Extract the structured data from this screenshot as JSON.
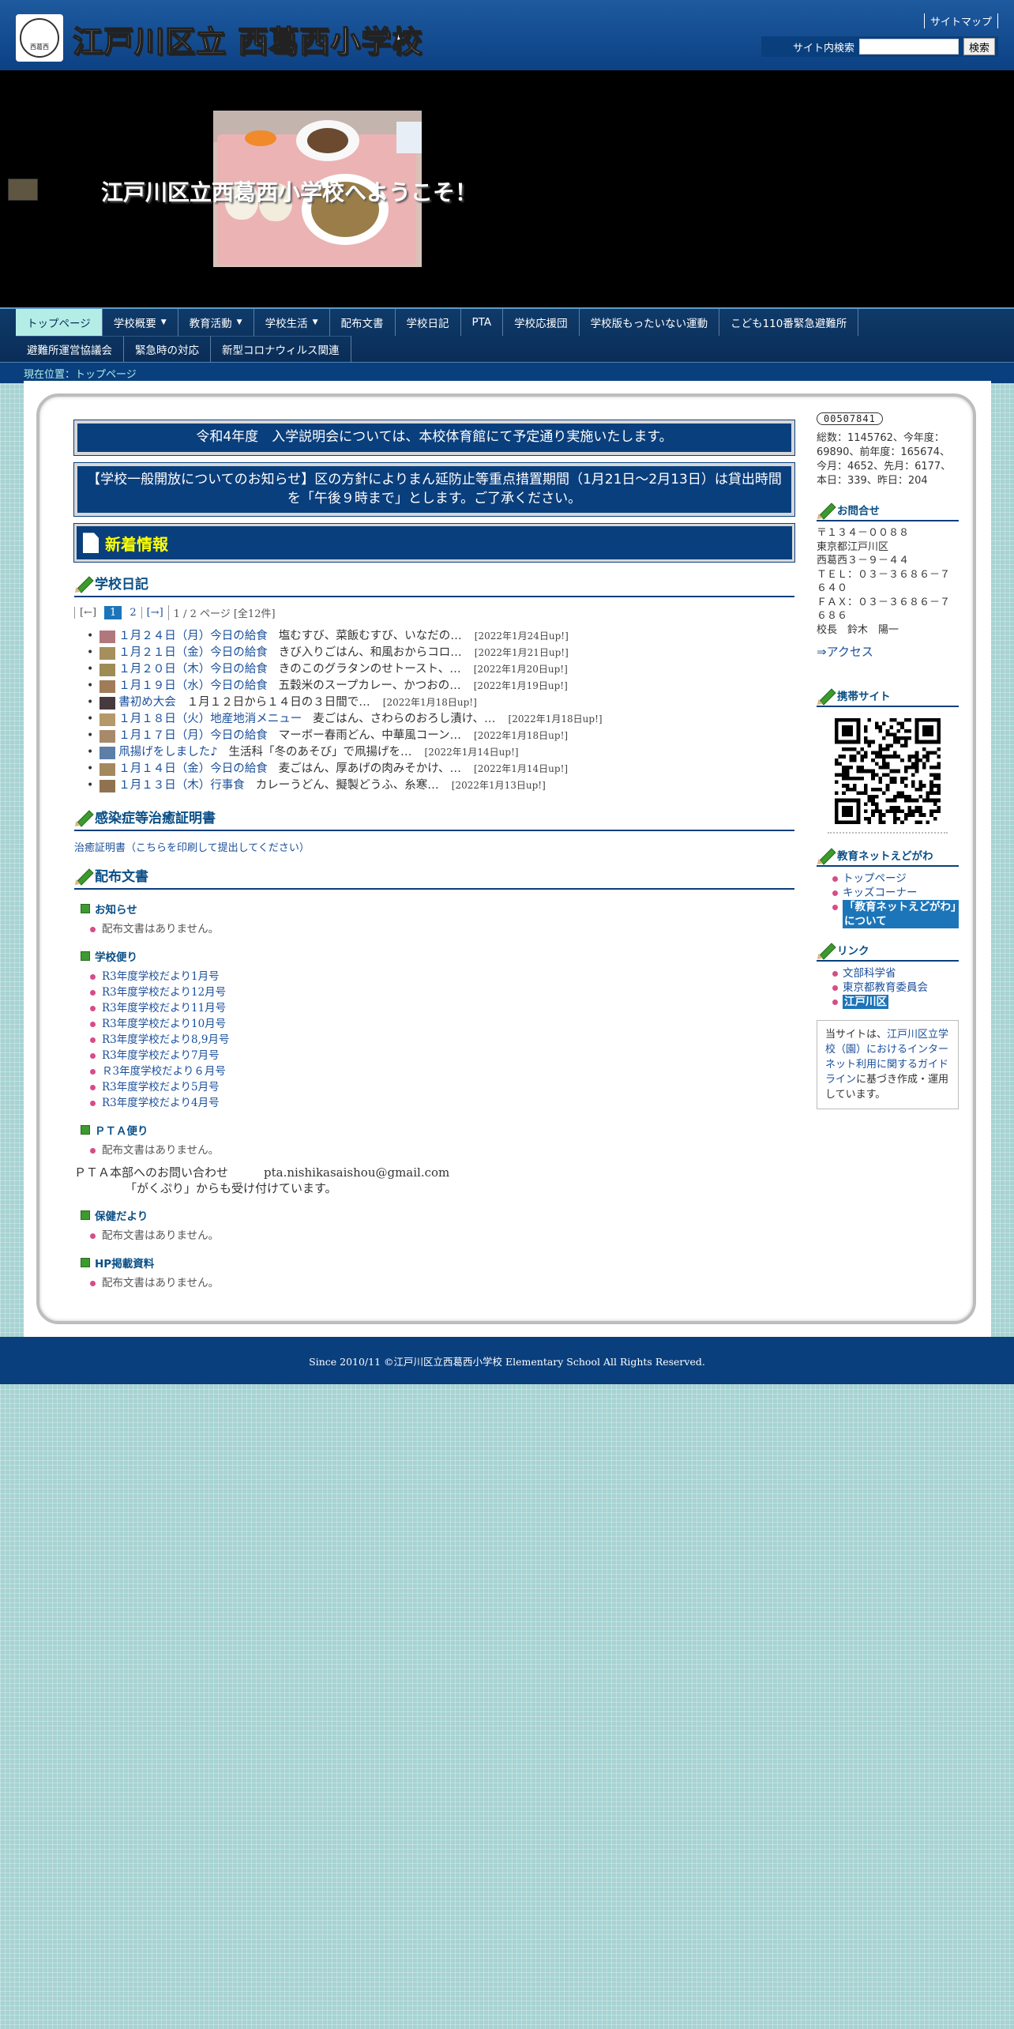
{
  "header": {
    "logo_alt": "西葛西",
    "site_title": "江戸川区立 西葛西小学校",
    "sitemap": "サイトマップ",
    "search_label": "サイト内検索",
    "search_value": "",
    "search_button": "検索"
  },
  "banner": {
    "title": "江戸川区立西葛西小学校へようこそ！"
  },
  "nav": {
    "row1": [
      {
        "label": "トップページ",
        "dropdown": false
      },
      {
        "label": "学校概要",
        "dropdown": true
      },
      {
        "label": "教育活動",
        "dropdown": true
      },
      {
        "label": "学校生活",
        "dropdown": true
      },
      {
        "label": "配布文書",
        "dropdown": false
      },
      {
        "label": "学校日記",
        "dropdown": false
      },
      {
        "label": "PTA",
        "dropdown": false
      },
      {
        "label": "学校応援団",
        "dropdown": false
      },
      {
        "label": "学校版もったいない運動",
        "dropdown": false
      },
      {
        "label": "こども110番緊急避難所",
        "dropdown": false
      }
    ],
    "row2": [
      {
        "label": "避難所運営協議会"
      },
      {
        "label": "緊急時の対応"
      },
      {
        "label": "新型コロナウィルス関連"
      }
    ],
    "caret": "▼"
  },
  "breadcrumb": "現在位置：トップページ",
  "notices": [
    "令和4年度　入学説明会については、本校体育館にて予定通り実施いたします。",
    "【学校一般開放についてのお知らせ】区の方針によりまん延防止等重点措置期間（1月21日～2月13日）は貸出時間を「午後９時まで」とします。ご了承ください。"
  ],
  "news_heading": "新着情報",
  "diary": {
    "title": "学校日記",
    "pager": {
      "prev": "[←]",
      "current": "1",
      "page2": "2",
      "next": "[→]",
      "info": "1 / 2 ページ [全12件]"
    },
    "items": [
      {
        "title": "１月２４日（月）今日の給食",
        "summary": "塩むすび、菜飯むすび、いなだの…",
        "date": "[2022年1月24日up!]",
        "color": "#b0787c"
      },
      {
        "title": "１月２１日（金）今日の給食",
        "summary": "きび入りごはん、和風おからコロ…",
        "date": "[2022年1月21日up!]",
        "color": "#a58f5c"
      },
      {
        "title": "１月２０日（木）今日の給食",
        "summary": "きのこのグラタンのせトースト、…",
        "date": "[2022年1月20日up!]",
        "color": "#9e8c54"
      },
      {
        "title": "１月１９日（水）今日の給食",
        "summary": "五穀米のスープカレー、かつおの…",
        "date": "[2022年1月19日up!]",
        "color": "#a07c58"
      },
      {
        "title": "書初め大会",
        "summary": "１月１２日から１４日の３日間で…",
        "date": "[2022年1月18日up!]",
        "color": "#463a3e"
      },
      {
        "title": "１月１８日（火）地産地消メニュー",
        "summary": "麦ごはん、さわらのおろし漬け、…",
        "date": "[2022年1月18日up!]",
        "color": "#b49a68"
      },
      {
        "title": "１月１７日（月）今日の給食",
        "summary": "マーボー春雨どん、中華風コーン…",
        "date": "[2022年1月18日up!]",
        "color": "#a88a6a"
      },
      {
        "title": "凧揚げをしました♪",
        "summary": "生活科「冬のあそび」で凧揚げを…",
        "date": "[2022年1月14日up!]",
        "color": "#5d7ea6"
      },
      {
        "title": "１月１４日（金）今日の給食",
        "summary": "麦ごはん、厚あげの肉みそかけ、…",
        "date": "[2022年1月14日up!]",
        "color": "#a4895e"
      },
      {
        "title": "１月１３日（木）行事食",
        "summary": "カレーうどん、擬製どうふ、糸寒…",
        "date": "[2022年1月13日up!]",
        "color": "#8f7350"
      }
    ]
  },
  "cert": {
    "title": "感染症等治癒証明書",
    "link": "治癒証明書（こちらを印刷して提出してください）"
  },
  "docs": {
    "title": "配布文書",
    "none_text": "配布文書はありません。",
    "categories": [
      {
        "name": "お知らせ",
        "items": []
      },
      {
        "name": "学校便り",
        "items": [
          "R3年度学校だより1月号",
          "R3年度学校だより12月号",
          "R3年度学校だより11月号",
          "R3年度学校だより10月号",
          "R3年度学校だより8,9月号",
          "R3年度学校だより7月号",
          "Ｒ3年度学校だより６月号",
          "R3年度学校だより5月号",
          "R3年度学校だより4月号"
        ]
      },
      {
        "name": "ＰＴＡ便り",
        "items": []
      },
      {
        "name": "保健だより",
        "items": []
      },
      {
        "name": "HP掲載資料",
        "items": []
      }
    ],
    "pta_contact_line1": "ＰＴＡ本部へのお問い合わせ　　　pta.nishikasaishou@gmail.com",
    "pta_contact_line2": "「がくぷり」からも受け付けています。"
  },
  "sidebar": {
    "counter": "00507841",
    "stats": "総数：1145762、今年度：69890、前年度：165674、今月：4652、先月：6177、本日：339、昨日：204",
    "contact_title": "お問合せ",
    "address_lines": [
      "〒１３４－００８８",
      "東京都江戸川区",
      "西葛西３－９－４４",
      "ＴＥＬ：０３－３６８６－７６４０",
      "ＦＡＸ：０３－３６８６－７６８６",
      "校長　鈴木　陽一"
    ],
    "access": "⇒アクセス",
    "mobile_title": "携帯サイト",
    "edunet_title": "教育ネットえどがわ",
    "edunet_items": [
      "トップページ",
      "キッズコーナー",
      "「教育ネットえどがわ」について"
    ],
    "links_title": "リンク",
    "links_items": [
      "文部科学省",
      "東京都教育委員会",
      "江戸川区"
    ],
    "guideline_pre": "当サイトは、",
    "guideline_link": "江戸川区立学校（園）におけるインターネット利用に関するガイドライン",
    "guideline_post": "に基づき作成・運用しています。"
  },
  "footer": "Since 2010/11 ©江戸川区立西葛西小学校 Elementary School All Rights Reserved.",
  "colors": {
    "brand": "#0a3f7d",
    "active_tab": "#b4ede6",
    "background": "#a7d3d3",
    "title_yellow": "#ffff00"
  }
}
